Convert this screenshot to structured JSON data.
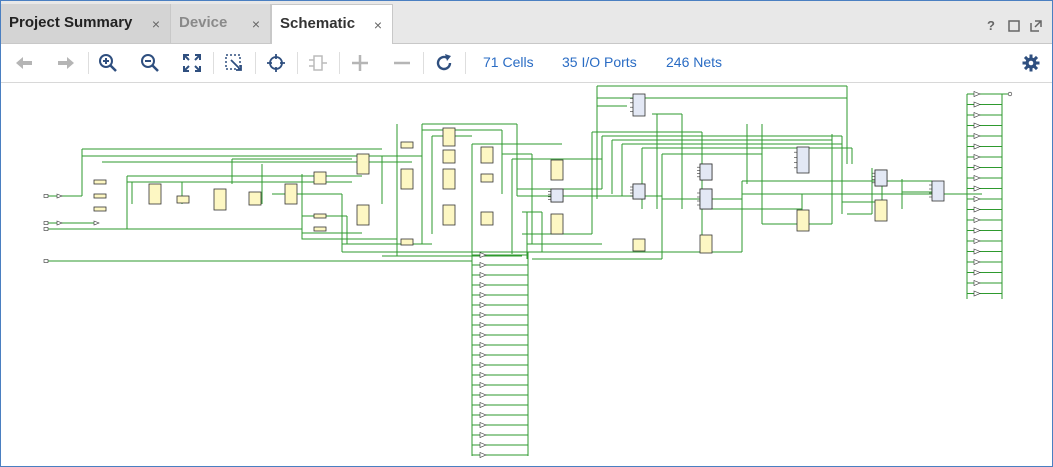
{
  "tabs": [
    {
      "label": "Project Summary",
      "close": "×"
    },
    {
      "label": "Device",
      "close": "×"
    },
    {
      "label": "Schematic",
      "close": "×"
    }
  ],
  "window_controls": {
    "help": "?"
  },
  "toolbar": {
    "links": {
      "cells": "71 Cells",
      "ports": "35 I/O Ports",
      "nets": "246 Nets"
    },
    "icons": [
      "back-icon",
      "forward-icon",
      "zoom-in-icon",
      "zoom-out-icon",
      "fit-icon",
      "zoom-area-icon",
      "select-icon",
      "cell-icon",
      "expand-icon",
      "collapse-icon",
      "refresh-icon",
      "settings-icon"
    ]
  },
  "colors": {
    "wire": "#2e9a2e",
    "cell_fill": "#fdf7c3",
    "cell_fill_blue": "#e3e8f5",
    "accent": "#2a6cc4",
    "frame": "#4a7fc1"
  }
}
